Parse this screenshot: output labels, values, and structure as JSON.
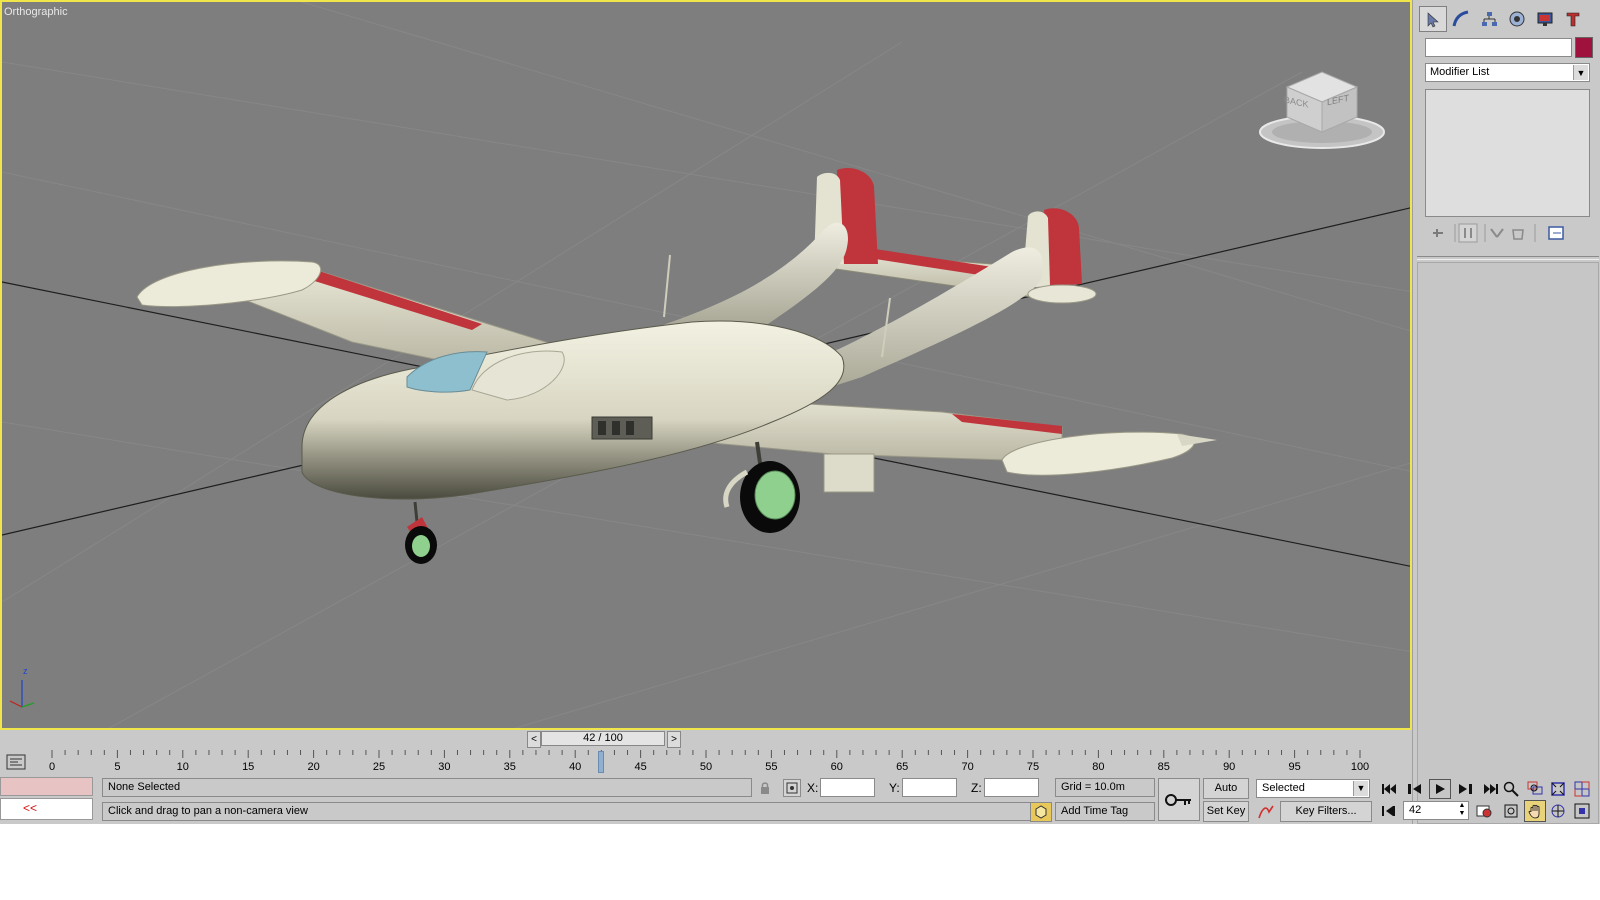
{
  "viewport": {
    "label": "Orthographic",
    "viewcube": {
      "face_back": "BACK",
      "face_left": "LEFT"
    },
    "axis_z_label": "z"
  },
  "command_panel": {
    "tabs": [
      "create-icon",
      "modify-icon",
      "hierarchy-icon",
      "motion-icon",
      "display-icon",
      "utilities-icon"
    ],
    "object_name": "",
    "object_color": "#a0123e",
    "modifier_list_label": "Modifier List"
  },
  "time_slider": {
    "prev_label": "<",
    "position_label": "42 / 100",
    "next_label": ">",
    "current_frame": 42,
    "total_frames": 100
  },
  "trackbar": {
    "ticks": [
      "0",
      "5",
      "10",
      "15",
      "20",
      "25",
      "30",
      "35",
      "40",
      "45",
      "50",
      "55",
      "60",
      "65",
      "70",
      "75",
      "80",
      "85",
      "90",
      "95",
      "100"
    ]
  },
  "status": {
    "maxscript_arrow": "<<",
    "selection_text": "None Selected",
    "prompt_text": "Click and drag to pan a non-camera view",
    "x_label": "X:",
    "y_label": "Y:",
    "z_label": "Z:",
    "x_value": "",
    "y_value": "",
    "z_value": "",
    "grid_text": "Grid = 10.0m",
    "add_time_tag": "Add Time Tag",
    "auto_key": "Auto Key",
    "set_key": "Set Key",
    "key_mode_selected": "Selected",
    "key_filters": "Key Filters...",
    "frame_field": "42"
  },
  "colors": {
    "viewport_bg": "#7e7e7e",
    "active_border": "#f0e64a",
    "airframe": "#e6e4d0",
    "trim_red": "#c0343c",
    "canopy": "#8ebfce",
    "wheel_hub": "#8fd08f"
  }
}
